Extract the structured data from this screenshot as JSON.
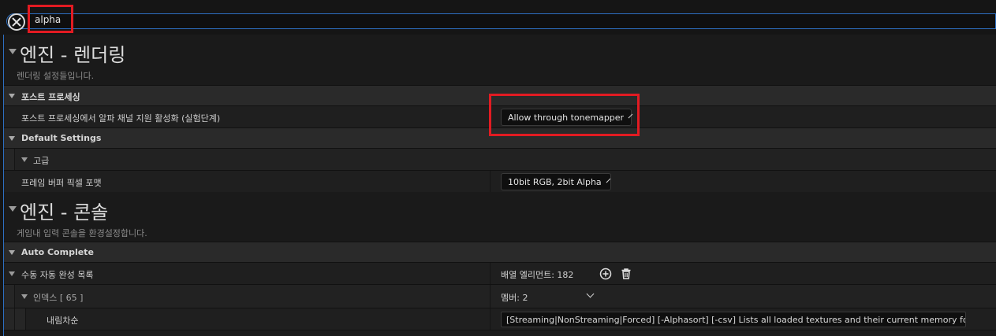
{
  "search": {
    "value": "alpha"
  },
  "sections": {
    "rendering": {
      "title": "엔진 - 렌더링",
      "subtitle": "렌더링 설정들입니다.",
      "post_process": {
        "category": "포스트 프로세싱",
        "alpha_label": "포스트 프로세싱에서 알파 채널 지원 활성화 (실험단계)",
        "alpha_value": "Allow through tonemapper"
      },
      "default_settings": {
        "category": "Default Settings",
        "advanced": "고급",
        "pixel_format_label": "프레임 버퍼 픽셀 포맷",
        "pixel_format_value": "10bit RGB, 2bit Alpha"
      }
    },
    "console": {
      "title": "엔진 - 콘솔",
      "subtitle": "게임내 입력 콘솔을 환경설정합니다.",
      "auto_complete": {
        "category": "Auto Complete",
        "manual_list_label": "수동 자동 완성 목록",
        "array_elements": "배열 엘리먼트: 182",
        "index_label": "인덱스 [ 65 ]",
        "members": "멤버: 2",
        "sort_label": "내림차순",
        "sort_value": "[Streaming|NonStreaming|Forced] [-Alphasort] [-csv] Lists all loaded textures and their current memory footprint"
      }
    }
  },
  "colors": {
    "highlight": "#e21b22",
    "focus_border": "#2d6fc2"
  },
  "icons": {
    "clear": "close-icon",
    "add": "plus-circle-icon",
    "delete": "trash-icon"
  }
}
